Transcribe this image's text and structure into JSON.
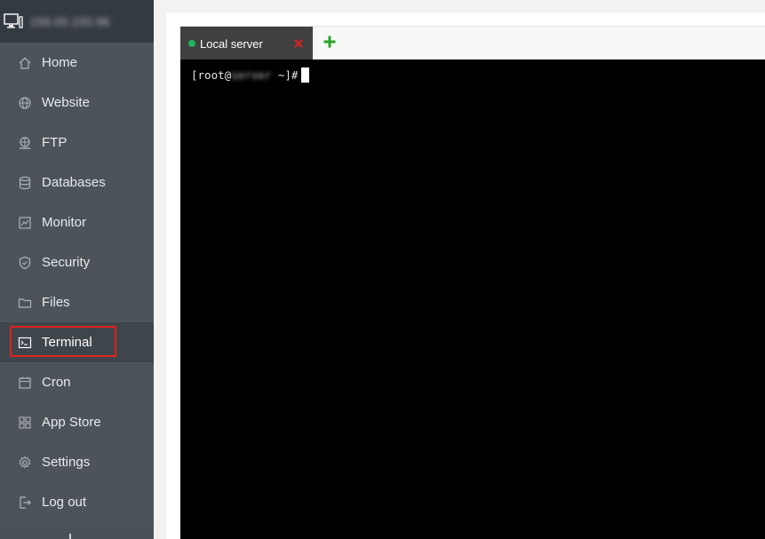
{
  "sidebar": {
    "server_ip": "156.00.150.96",
    "items": [
      {
        "label": "Home",
        "icon": "home-icon"
      },
      {
        "label": "Website",
        "icon": "globe-icon"
      },
      {
        "label": "FTP",
        "icon": "ftp-icon"
      },
      {
        "label": "Databases",
        "icon": "database-icon"
      },
      {
        "label": "Monitor",
        "icon": "monitor-chart-icon"
      },
      {
        "label": "Security",
        "icon": "shield-icon"
      },
      {
        "label": "Files",
        "icon": "folder-icon"
      },
      {
        "label": "Terminal",
        "icon": "terminal-icon",
        "active": true
      },
      {
        "label": "Cron",
        "icon": "calendar-icon"
      },
      {
        "label": "App Store",
        "icon": "grid-icon"
      },
      {
        "label": "Settings",
        "icon": "gear-icon"
      },
      {
        "label": "Log out",
        "icon": "logout-icon"
      }
    ]
  },
  "terminal": {
    "tabs": [
      {
        "label": "Local server",
        "status": "connected"
      }
    ],
    "prompt_prefix": "[root@",
    "prompt_host": "server",
    "prompt_suffix": " ~]#"
  },
  "colors": {
    "sidebar_bg": "#4c545a",
    "sidebar_active_bg": "#3f464b",
    "highlight_border": "#e02020",
    "status_green": "#21b35d",
    "add_green": "#2aa52a",
    "close_red": "#e02020"
  }
}
